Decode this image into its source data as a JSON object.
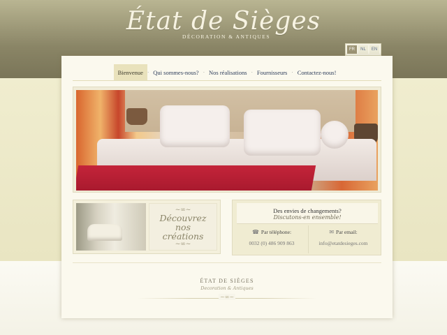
{
  "brand": {
    "title": "État de Sièges",
    "subtitle": "DÉCORATION & ANTIQUES"
  },
  "languages": [
    {
      "code": "FR",
      "active": true
    },
    {
      "code": "NL",
      "active": false
    },
    {
      "code": "EN",
      "active": false
    }
  ],
  "nav": {
    "items": [
      {
        "label": "Bienvenue",
        "active": true
      },
      {
        "label": "Qui sommes-nous?",
        "active": false
      },
      {
        "label": "Nos réalisations",
        "active": false
      },
      {
        "label": "Fournisseurs",
        "active": false
      },
      {
        "label": "Contactez-nous!",
        "active": false
      }
    ],
    "separator": "·"
  },
  "promo": {
    "label": "Découvrez nos créations",
    "flourish": "~∞~"
  },
  "contact": {
    "question": "Des envies de changements?",
    "tagline": "Discutons-en ensemble!",
    "phone_label": "Par téléphone:",
    "phone_value": "0032 (0) 486 909 863",
    "phone_icon": "phone-icon",
    "email_label": "Par email:",
    "email_value": "info@etatdesieges.com",
    "email_icon": "envelope-icon"
  },
  "footer": {
    "title": "ÉTAT DE SIÈGES",
    "subtitle": "Decoration & Antiques",
    "ornament": "~∞~"
  },
  "colors": {
    "header": "#8a8566",
    "accent_tab": "#e9e2bc",
    "nav_text": "#2d3c5a",
    "throw_red": "#c4243a"
  }
}
